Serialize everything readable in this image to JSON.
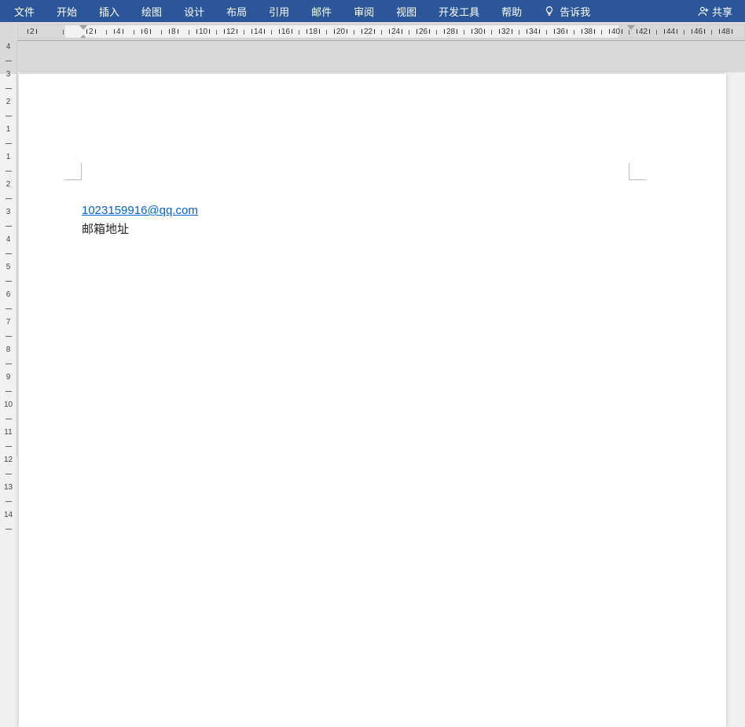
{
  "ribbon": {
    "tabs": [
      "文件",
      "开始",
      "插入",
      "绘图",
      "设计",
      "布局",
      "引用",
      "邮件",
      "审阅",
      "视图",
      "开发工具",
      "帮助"
    ],
    "tell_me": "告诉我",
    "share": "共享"
  },
  "horizontal_ruler": {
    "ticks": [
      "2",
      "2",
      "4",
      "6",
      "8",
      "10",
      "12",
      "14",
      "16",
      "18",
      "20",
      "22",
      "24",
      "26",
      "28",
      "30",
      "32",
      "34",
      "36",
      "38",
      "40",
      "42",
      "44",
      "46",
      "48"
    ]
  },
  "vertical_ruler": {
    "ticks": [
      "4",
      "3",
      "2",
      "1",
      "1",
      "2",
      "3",
      "4",
      "5",
      "6",
      "7",
      "8",
      "9",
      "10",
      "11",
      "12",
      "13",
      "14"
    ]
  },
  "document": {
    "link_text": "1023159916@qq.com",
    "body_line2": "邮箱地址"
  }
}
